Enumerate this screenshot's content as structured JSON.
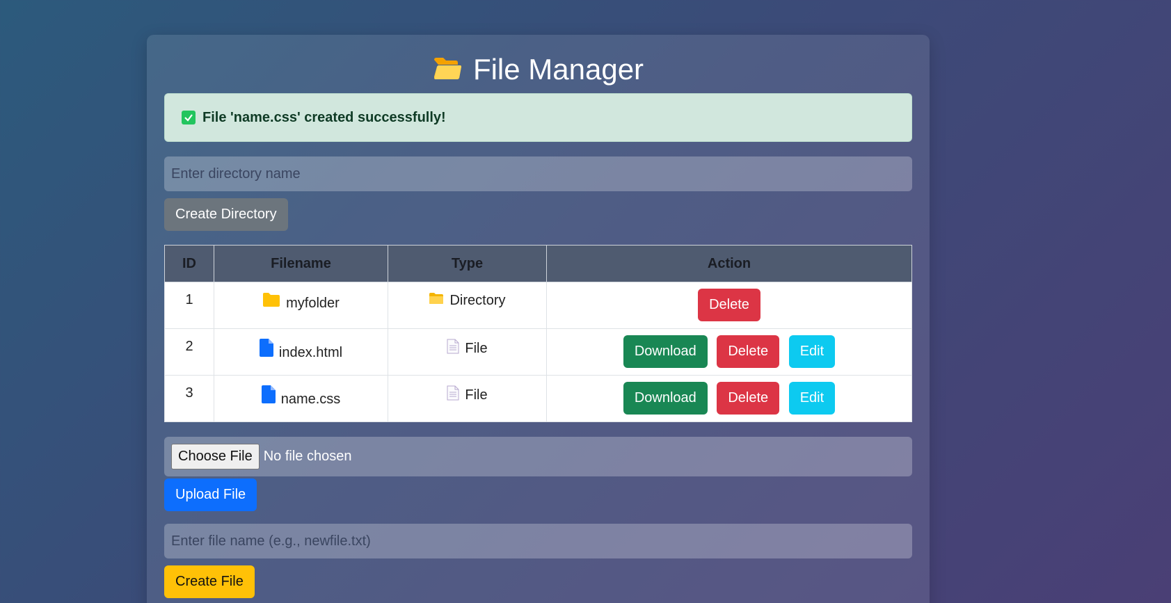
{
  "header": {
    "title": "File Manager",
    "icon": "open-folder-icon"
  },
  "alert": {
    "message": "File 'name.css' created successfully!",
    "icon": "check-icon"
  },
  "create_directory": {
    "placeholder": "Enter directory name",
    "button_label": "Create Directory"
  },
  "table": {
    "headers": [
      "ID",
      "Filename",
      "Type",
      "Action"
    ],
    "rows": [
      {
        "id": "1",
        "filename": "myfolder",
        "type": "Directory",
        "filename_icon": "folder-icon",
        "type_icon": "folder-icon",
        "actions": [
          "Delete"
        ]
      },
      {
        "id": "2",
        "filename": "index.html",
        "type": "File",
        "filename_icon": "file-icon",
        "type_icon": "document-icon",
        "actions": [
          "Download",
          "Delete",
          "Edit"
        ]
      },
      {
        "id": "3",
        "filename": "name.css",
        "type": "File",
        "filename_icon": "file-icon",
        "type_icon": "document-icon",
        "actions": [
          "Download",
          "Delete",
          "Edit"
        ]
      }
    ]
  },
  "upload": {
    "choose_label": "Choose File",
    "no_file_text": "No file chosen",
    "button_label": "Upload File"
  },
  "create_file": {
    "placeholder": "Enter file name (e.g., newfile.txt)",
    "button_label": "Create File"
  },
  "colors": {
    "success": "#198754",
    "danger": "#dc3545",
    "info": "#0dcaf0",
    "primary": "#0d6efd",
    "warning": "#ffc107",
    "secondary": "#6c757d"
  }
}
